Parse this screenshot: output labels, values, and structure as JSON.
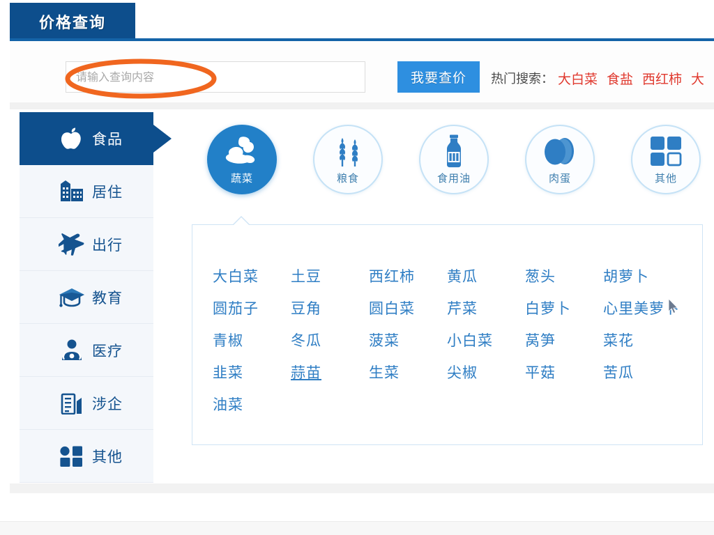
{
  "tab": {
    "active_label": "价格查询"
  },
  "search": {
    "placeholder": "请输入查询内容",
    "value": "",
    "button_label": "我要查价",
    "hot_label": "热门搜索：",
    "hot_terms": [
      "大白菜",
      "食盐",
      "西红柿",
      "大"
    ],
    "hot_color": "#e0392e",
    "button_color": "#2e8fe0"
  },
  "annotation": {
    "shape": "ellipse-highlight",
    "color": "#f0661f",
    "targets": "search-input"
  },
  "sidebar": {
    "items": [
      {
        "label": "食品",
        "icon": "apple-icon",
        "active": true
      },
      {
        "label": "居住",
        "icon": "building-icon",
        "active": false
      },
      {
        "label": "出行",
        "icon": "airplane-icon",
        "active": false
      },
      {
        "label": "教育",
        "icon": "graduation-cap-icon",
        "active": false
      },
      {
        "label": "医疗",
        "icon": "stethoscope-icon",
        "active": false
      },
      {
        "label": "涉企",
        "icon": "office-building-icon",
        "active": false
      },
      {
        "label": "其他",
        "icon": "grid-icon",
        "active": false
      }
    ],
    "active_bg": "#0d4e8c",
    "item_bg": "#f4f7fb"
  },
  "categories": [
    {
      "label": "蔬菜",
      "icon": "cabbage-icon",
      "active": true
    },
    {
      "label": "粮食",
      "icon": "wheat-icon",
      "active": false
    },
    {
      "label": "食用油",
      "icon": "oil-bottle-icon",
      "active": false
    },
    {
      "label": "肉蛋",
      "icon": "eggs-icon",
      "active": false
    },
    {
      "label": "其他",
      "icon": "four-squares-icon",
      "active": false
    }
  ],
  "panel": {
    "items": [
      {
        "label": "大白菜",
        "hovered": false
      },
      {
        "label": "土豆",
        "hovered": false
      },
      {
        "label": "西红柿",
        "hovered": false
      },
      {
        "label": "黄瓜",
        "hovered": false
      },
      {
        "label": "葱头",
        "hovered": false
      },
      {
        "label": "胡萝卜",
        "hovered": false
      },
      {
        "label": "圆茄子",
        "hovered": false
      },
      {
        "label": "豆角",
        "hovered": false
      },
      {
        "label": "圆白菜",
        "hovered": false
      },
      {
        "label": "芹菜",
        "hovered": false
      },
      {
        "label": "白萝卜",
        "hovered": false
      },
      {
        "label": "心里美萝卜",
        "hovered": false
      },
      {
        "label": "青椒",
        "hovered": false
      },
      {
        "label": "冬瓜",
        "hovered": false
      },
      {
        "label": "菠菜",
        "hovered": false
      },
      {
        "label": "小白菜",
        "hovered": false
      },
      {
        "label": "莴笋",
        "hovered": false
      },
      {
        "label": "菜花",
        "hovered": false
      },
      {
        "label": "韭菜",
        "hovered": false
      },
      {
        "label": "蒜苗",
        "hovered": true
      },
      {
        "label": "生菜",
        "hovered": false
      },
      {
        "label": "尖椒",
        "hovered": false
      },
      {
        "label": "平菇",
        "hovered": false
      },
      {
        "label": "苦瓜",
        "hovered": false
      },
      {
        "label": "油菜",
        "hovered": false
      }
    ],
    "columns": 6,
    "link_color": "#2f7ec4",
    "border_color": "#cfe4f5"
  }
}
